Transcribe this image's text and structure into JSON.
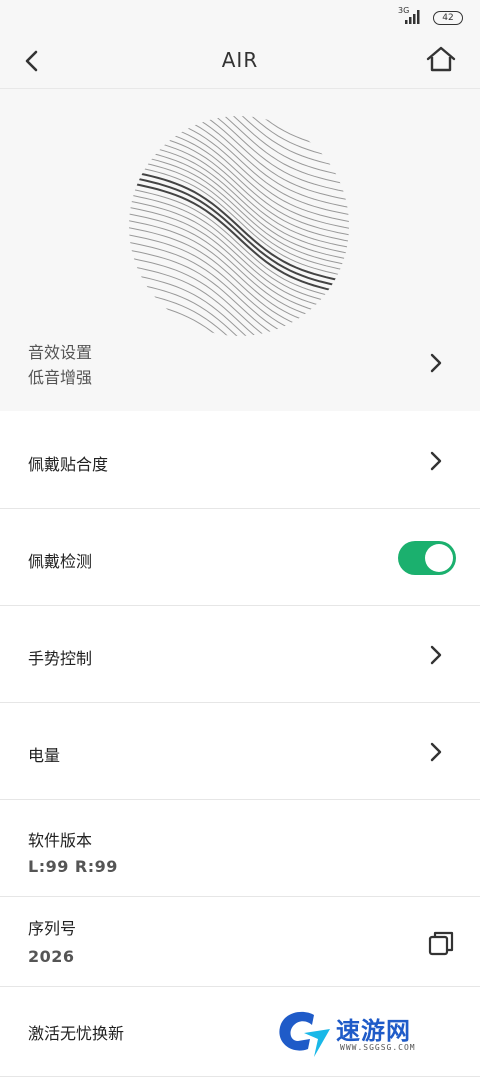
{
  "status": {
    "network": "3G",
    "battery": "42"
  },
  "nav": {
    "title": "AIR"
  },
  "sound": {
    "label": "音效设置",
    "value": "低音增强"
  },
  "rows": {
    "fit": "佩戴贴合度",
    "detect": "佩戴检测",
    "gesture": "手势控制",
    "power": "电量",
    "version_label": "软件版本",
    "version_value": "L:99  R:99",
    "serial_label": "序列号",
    "serial_value": "2026",
    "replace": "激活无忧换新"
  },
  "toggle": {
    "detect_on": true
  },
  "watermark": {
    "name": "速游网",
    "url": "WWW.SGGSG.COM"
  },
  "colors": {
    "accent": "#1bb06e",
    "bg_header": "#f7f7f7",
    "watermark": "#1f5bc8"
  },
  "icons": [
    "back-icon",
    "home-icon",
    "chevron-right-icon",
    "copy-icon",
    "signal-icon",
    "battery-icon"
  ]
}
